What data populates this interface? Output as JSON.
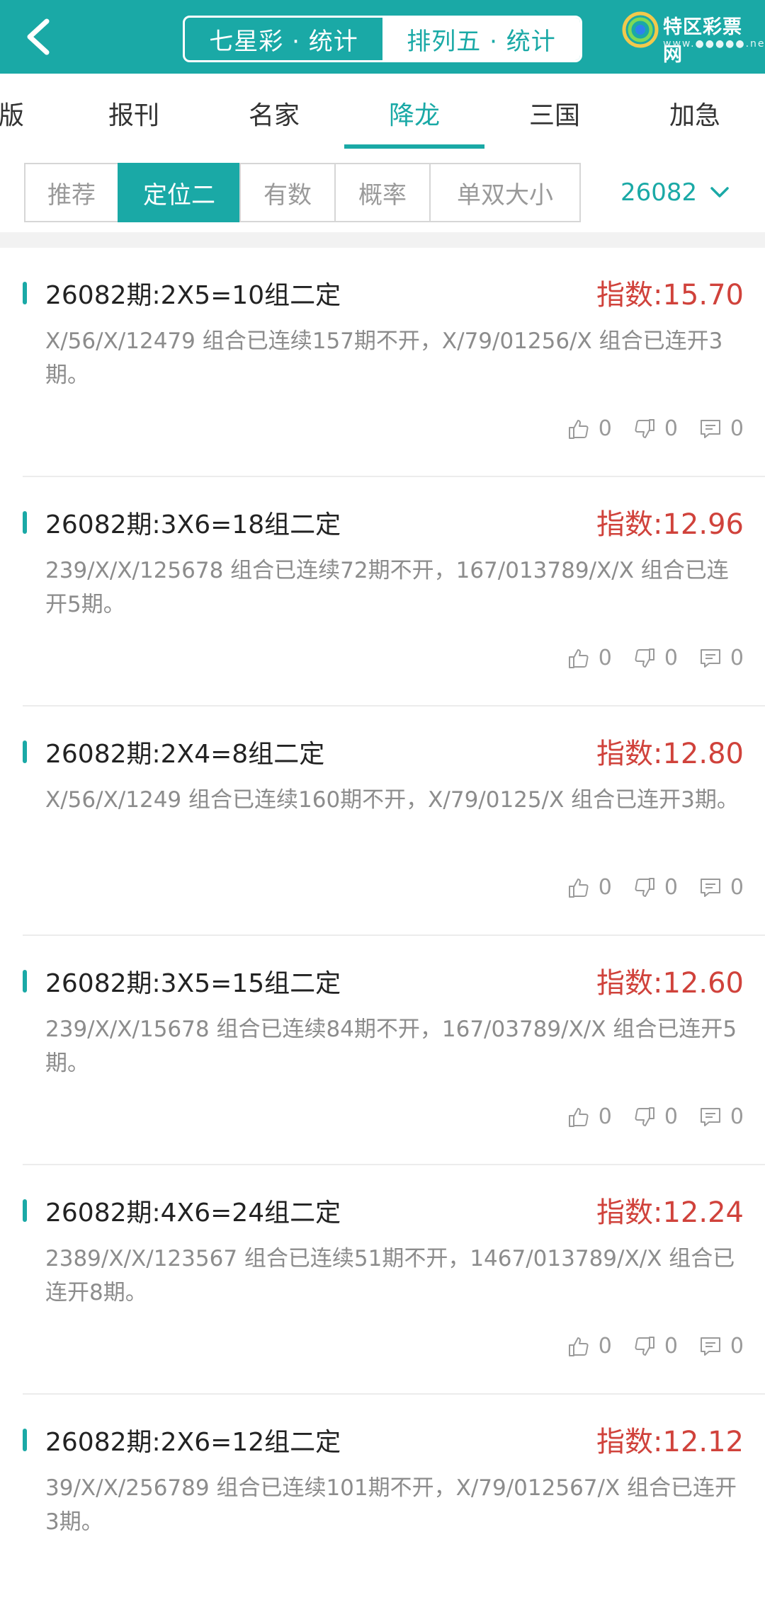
{
  "header": {
    "seg_left": "七星彩 · 统计",
    "seg_right": "排列五 · 统计",
    "logo_text": "特区彩票网",
    "logo_sub": "www.●●●●●.net"
  },
  "tabs": [
    "版",
    "报刊",
    "名家",
    "降龙",
    "三国",
    "加急"
  ],
  "active_tab": "降龙",
  "filters": [
    "推荐",
    "定位二",
    "有数",
    "概率",
    "单双大小"
  ],
  "active_filter": "定位二",
  "period": "26082",
  "colors": {
    "accent": "#1aa9a6",
    "index_red": "#d0423b"
  },
  "cards": [
    {
      "title": "26082期:2X5=10组二定",
      "index": "指数:15.70",
      "desc": "X/56/X/12479 组合已连续157期不开，X/79/01256/X 组合已连开3期。",
      "likes": "0",
      "dislikes": "0",
      "comments": "0"
    },
    {
      "title": "26082期:3X6=18组二定",
      "index": "指数:12.96",
      "desc": "239/X/X/125678 组合已连续72期不开，167/013789/X/X 组合已连开5期。",
      "likes": "0",
      "dislikes": "0",
      "comments": "0"
    },
    {
      "title": "26082期:2X4=8组二定",
      "index": "指数:12.80",
      "desc": "X/56/X/1249 组合已连续160期不开，X/79/0125/X 组合已连开3期。",
      "likes": "0",
      "dislikes": "0",
      "comments": "0"
    },
    {
      "title": "26082期:3X5=15组二定",
      "index": "指数:12.60",
      "desc": "239/X/X/15678 组合已连续84期不开，167/03789/X/X 组合已连开5期。",
      "likes": "0",
      "dislikes": "0",
      "comments": "0"
    },
    {
      "title": "26082期:4X6=24组二定",
      "index": "指数:12.24",
      "desc": "2389/X/X/123567 组合已连续51期不开，1467/013789/X/X 组合已连开8期。",
      "likes": "0",
      "dislikes": "0",
      "comments": "0"
    },
    {
      "title": "26082期:2X6=12组二定",
      "index": "指数:12.12",
      "desc": "39/X/X/256789 组合已连续101期不开，X/79/012567/X 组合已连开3期。",
      "likes": "",
      "dislikes": "",
      "comments": ""
    }
  ]
}
